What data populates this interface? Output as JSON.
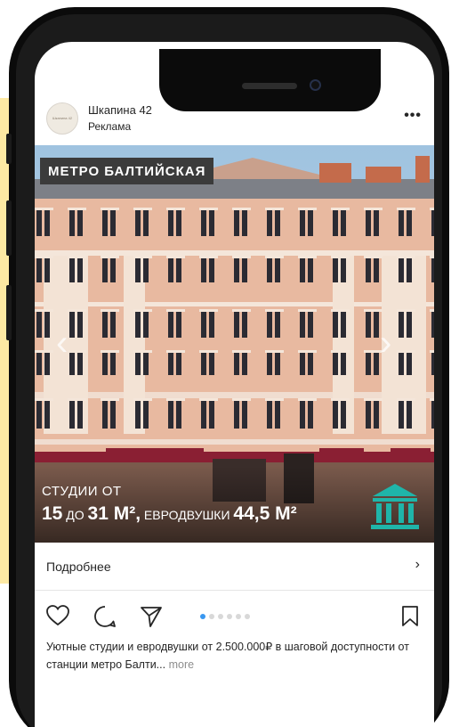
{
  "post": {
    "account_name": "Шкапина 42",
    "sponsored_label": "Реклама",
    "avatar_text": "Шкапина 42",
    "more_icon": "more-horizontal-icon"
  },
  "ad": {
    "badge": "МЕТРО БАЛТИЙСКАЯ",
    "caption_line1": "СТУДИИ ОТ",
    "caption_a": "15",
    "caption_b": " ДО ",
    "caption_c": "31 М²,",
    "caption_d": " ЕВРОДВУШКИ ",
    "caption_e": "44,5 М²",
    "prev_icon": "chevron-left-icon",
    "next_icon": "chevron-right-icon",
    "logo_icon": "building-columns-icon",
    "logo_color": "#1fb5a9"
  },
  "cta": {
    "label": "Подробнее",
    "chevron": "›"
  },
  "actions": {
    "like_icon": "heart-icon",
    "comment_icon": "comment-icon",
    "share_icon": "send-icon",
    "save_icon": "bookmark-icon",
    "carousel_pages": 6,
    "carousel_active": 1
  },
  "description": {
    "text": "Уютные студии и евродвушки от 2.500.000₽ в шаговой доступности от станции метро Балти...",
    "more": "more"
  },
  "colors": {
    "accent": "#3897f0",
    "facade": "#e8b9a0",
    "awning": "#8a1f33"
  }
}
